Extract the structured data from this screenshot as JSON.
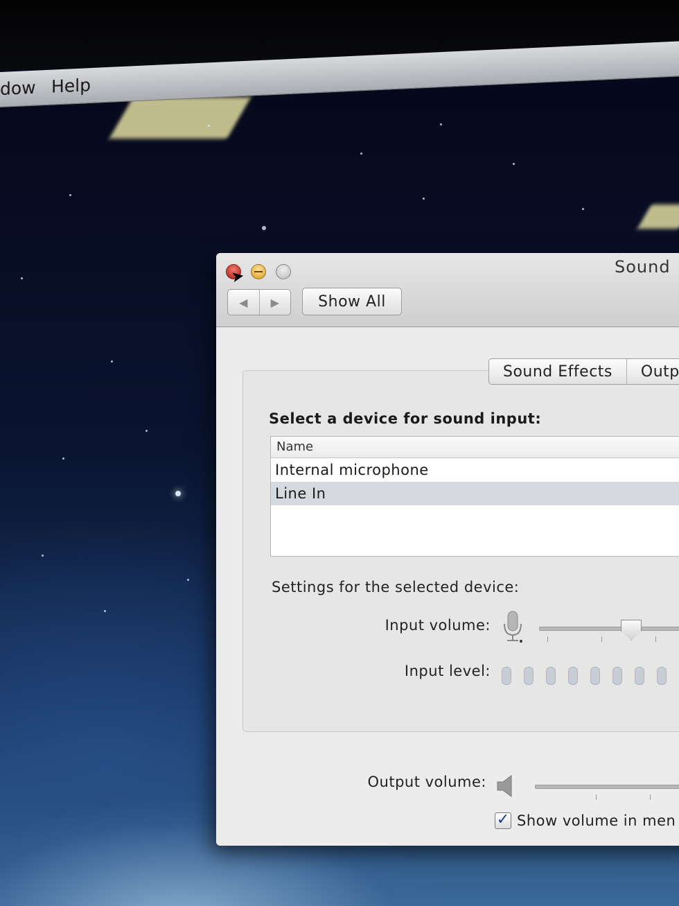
{
  "menubar": {
    "items": [
      "dow",
      "Help"
    ]
  },
  "window": {
    "title": "Sound",
    "show_all_label": "Show All",
    "nav_back_icon": "◀",
    "nav_forward_icon": "▶"
  },
  "tabs": [
    {
      "label": "Sound Effects"
    },
    {
      "label": "Outp"
    }
  ],
  "input": {
    "heading": "Select a device for sound input:",
    "column_header": "Name",
    "devices": [
      {
        "name": "Internal microphone"
      },
      {
        "name": "Line In"
      }
    ],
    "selected_device": "Line In"
  },
  "settings": {
    "heading": "Settings for the selected device:",
    "input_volume_label": "Input volume:",
    "input_level_label": "Input level:",
    "input_volume_fraction": 0.55,
    "input_level_segments": 9,
    "input_level_active": 0
  },
  "output": {
    "volume_label": "Output volume:",
    "show_volume_label": "Show volume in men",
    "show_volume_checked": true,
    "checkmark": "✓"
  },
  "icons": {
    "close": "close-icon",
    "minimize": "minimize-icon",
    "zoom": "zoom-icon",
    "microphone": "microphone-icon",
    "speaker": "speaker-icon"
  },
  "colors": {
    "close_button": "#c0281c",
    "minimize_button": "#e7b233",
    "selected_row": "#d6d9de",
    "checkmark": "#1a3f8a"
  }
}
